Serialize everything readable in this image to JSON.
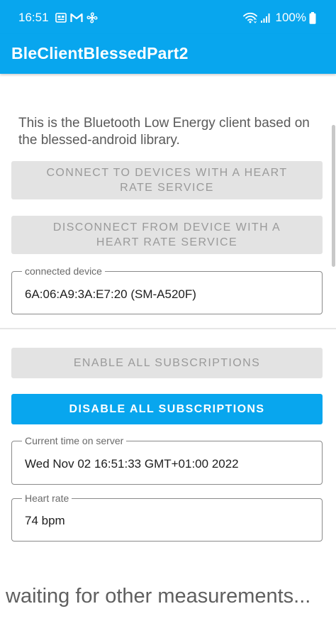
{
  "status_bar": {
    "time": "16:51",
    "battery_percent": "100%",
    "icons_left": [
      "gallery-icon",
      "gmail-icon",
      "fan-icon"
    ],
    "icons_right": [
      "wifi-icon",
      "signal-icon",
      "battery-icon"
    ]
  },
  "app_bar": {
    "title": "BleClientBlessedPart2",
    "color": "#08a6ee"
  },
  "intro": {
    "text": "This is the Bluetooth Low Energy client based on the blessed-android library."
  },
  "buttons": {
    "connect_label": "CONNECT TO DEVICES WITH A HEART RATE SERVICE",
    "disconnect_label": "DISCONNECT FROM DEVICE WITH A HEART RATE SERVICE",
    "enable_all_label": "ENABLE ALL SUBSCRIPTIONS",
    "disable_all_label": "DISABLE ALL SUBSCRIPTIONS"
  },
  "fields": {
    "connected_device": {
      "label": "connected device",
      "value": "6A:06:A9:3A:E7:20 (SM-A520F)"
    },
    "current_time": {
      "label": "Current time on server",
      "value": "Wed Nov 02 16:51:33 GMT+01:00 2022"
    },
    "heart_rate": {
      "label": "Heart rate",
      "value": "74 bpm"
    }
  },
  "footer": {
    "waiting_text": "waiting for other measurements..."
  }
}
